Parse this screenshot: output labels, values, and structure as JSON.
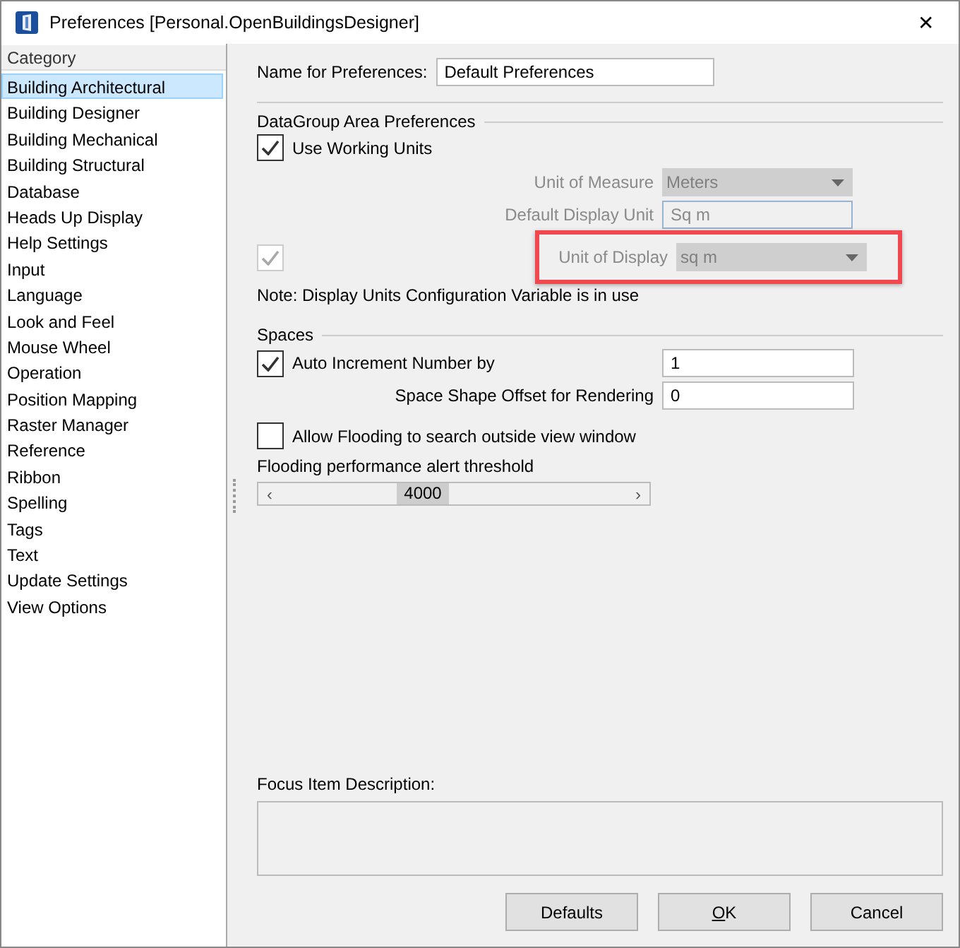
{
  "window": {
    "title": "Preferences [Personal.OpenBuildingsDesigner]",
    "close": "✕"
  },
  "sidebar": {
    "header": "Category",
    "items": [
      {
        "label": "Building Architectural",
        "selected": true
      },
      {
        "label": "Building Designer",
        "selected": false
      },
      {
        "label": "Building Mechanical",
        "selected": false
      },
      {
        "label": "Building Structural",
        "selected": false
      },
      {
        "label": "Database",
        "selected": false
      },
      {
        "label": "Heads Up Display",
        "selected": false
      },
      {
        "label": "Help Settings",
        "selected": false
      },
      {
        "label": "Input",
        "selected": false
      },
      {
        "label": "Language",
        "selected": false
      },
      {
        "label": "Look and Feel",
        "selected": false
      },
      {
        "label": "Mouse Wheel",
        "selected": false
      },
      {
        "label": "Operation",
        "selected": false
      },
      {
        "label": "Position Mapping",
        "selected": false
      },
      {
        "label": "Raster Manager",
        "selected": false
      },
      {
        "label": "Reference",
        "selected": false
      },
      {
        "label": "Ribbon",
        "selected": false
      },
      {
        "label": "Spelling",
        "selected": false
      },
      {
        "label": "Tags",
        "selected": false
      },
      {
        "label": "Text",
        "selected": false
      },
      {
        "label": "Update Settings",
        "selected": false
      },
      {
        "label": "View Options",
        "selected": false
      }
    ]
  },
  "name_for_preferences": {
    "label": "Name for Preferences:",
    "value": "Default Preferences"
  },
  "datagroup": {
    "title": "DataGroup Area Preferences",
    "use_working_units": {
      "label": "Use Working Units",
      "checked": true,
      "disabled": false
    },
    "unit_of_measure": {
      "label": "Unit of Measure",
      "value": "Meters",
      "disabled": true
    },
    "default_display_unit": {
      "label": "Default Display Unit",
      "value": "Sq m",
      "disabled": true
    },
    "display_override": {
      "checked": true,
      "disabled": true
    },
    "unit_of_display": {
      "label": "Unit of Display",
      "value": "sq m",
      "disabled": true,
      "highlighted": true
    },
    "note": "Note: Display Units Configuration Variable is in use"
  },
  "spaces": {
    "title": "Spaces",
    "auto_increment": {
      "label": "Auto Increment Number by",
      "checked": true,
      "value": "1"
    },
    "shape_offset": {
      "label": "Space Shape Offset for Rendering",
      "value": "0"
    },
    "allow_flooding": {
      "label": "Allow Flooding to search outside view window",
      "checked": false
    },
    "threshold": {
      "label": "Flooding performance alert threshold",
      "reading": "4000",
      "level": 0.4,
      "left": "‹",
      "right": "›"
    }
  },
  "focus_description": {
    "label": "Focus Item Description:"
  },
  "buttons": [
    {
      "label": "Defaults",
      "kind": "plain"
    },
    {
      "label": "OK",
      "kind": "mnemonic"
    },
    {
      "label": "Cancel",
      "kind": "plain"
    }
  ]
}
